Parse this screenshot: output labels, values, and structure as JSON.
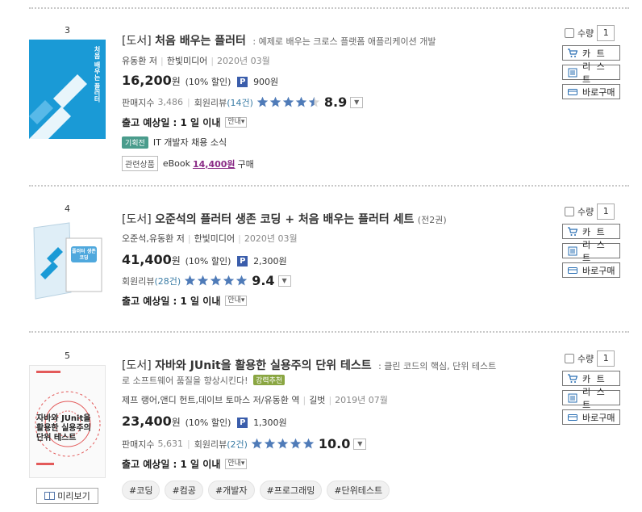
{
  "books": [
    {
      "rank": "3",
      "category": "[도서]",
      "title": "처음 배우는 플러터",
      "subtitle": ": 예제로 배우는 크로스 플랫폼 애플리케이션 개발",
      "author": "유동환 저",
      "publisher": "한빛미디어",
      "date": "2020년 03월",
      "price": "16,200",
      "won": "원",
      "discount": "(10% 할인)",
      "points": "900원",
      "sales_label": "판매지수",
      "sales_index": "3,486",
      "review_label": "회원리뷰",
      "review_count": "(14건)",
      "rating_stars": 4.5,
      "score": "8.9",
      "shipping": "출고 예상일 : 1 일 이내",
      "guide": "안내",
      "promo_tag": "기획전",
      "promo_text": "IT 개발자 채용 소식",
      "related_label": "관련상품",
      "related_ebook": "eBook",
      "related_price": "14,400원",
      "related_buy": "구매",
      "cover_text": "처음 배우는 플러터"
    },
    {
      "rank": "4",
      "category": "[도서]",
      "title": "오준석의 플러터 생존 코딩 + 처음 배우는 플러터 세트",
      "subtitle": "(전2권)",
      "author": "오준석,유동환 저",
      "publisher": "한빛미디어",
      "date": "2020년 03월",
      "price": "41,400",
      "won": "원",
      "discount": "(10% 할인)",
      "points": "2,300원",
      "review_label": "회원리뷰",
      "review_count": "(28건)",
      "rating_stars": 5,
      "score": "9.4",
      "shipping": "출고 예상일 : 1 일 이내",
      "guide": "안내",
      "cover_text": "플러터 생존코딩"
    },
    {
      "rank": "5",
      "category": "[도서]",
      "title": "자바와 JUnit을 활용한 실용주의 단위 테스트",
      "subtitle": ": 클린 코드의 핵심, 단위 테스트",
      "subtitle2": "로 소프트웨어 품질을 향상시킨다!",
      "strong_rec": "강력추천",
      "author": "제프 랭어,앤디 헌트,데이브 토마스 저/유동환 역",
      "publisher": "길벗",
      "date": "2019년 07월",
      "price": "23,400",
      "won": "원",
      "discount": "(10% 할인)",
      "points": "1,300원",
      "sales_label": "판매지수",
      "sales_index": "5,631",
      "review_label": "회원리뷰",
      "review_count": "(2건)",
      "rating_stars": 5,
      "score": "10.0",
      "shipping": "출고 예상일 : 1 일 이내",
      "guide": "안내",
      "hashtags": [
        "#코딩",
        "#컴공",
        "#개발자",
        "#프로그래밍",
        "#단위테스트"
      ],
      "preview": "미리보기",
      "cover_text": "자바와 JUnit을 활용한 실용주의 단위 테스트"
    }
  ],
  "actions": {
    "qty_label": "수량",
    "qty_value": "1",
    "cart": "카 트",
    "list": "리 스 트",
    "buy_now": "바로구매"
  },
  "colors": {
    "star": "#4f7bb8",
    "points_badge": "#3a5dab",
    "related_price": "#8a2b86",
    "promo_tag": "#4a9c8c",
    "strong_rec": "#8aa642",
    "cover_blue": "#1a9ad6"
  }
}
